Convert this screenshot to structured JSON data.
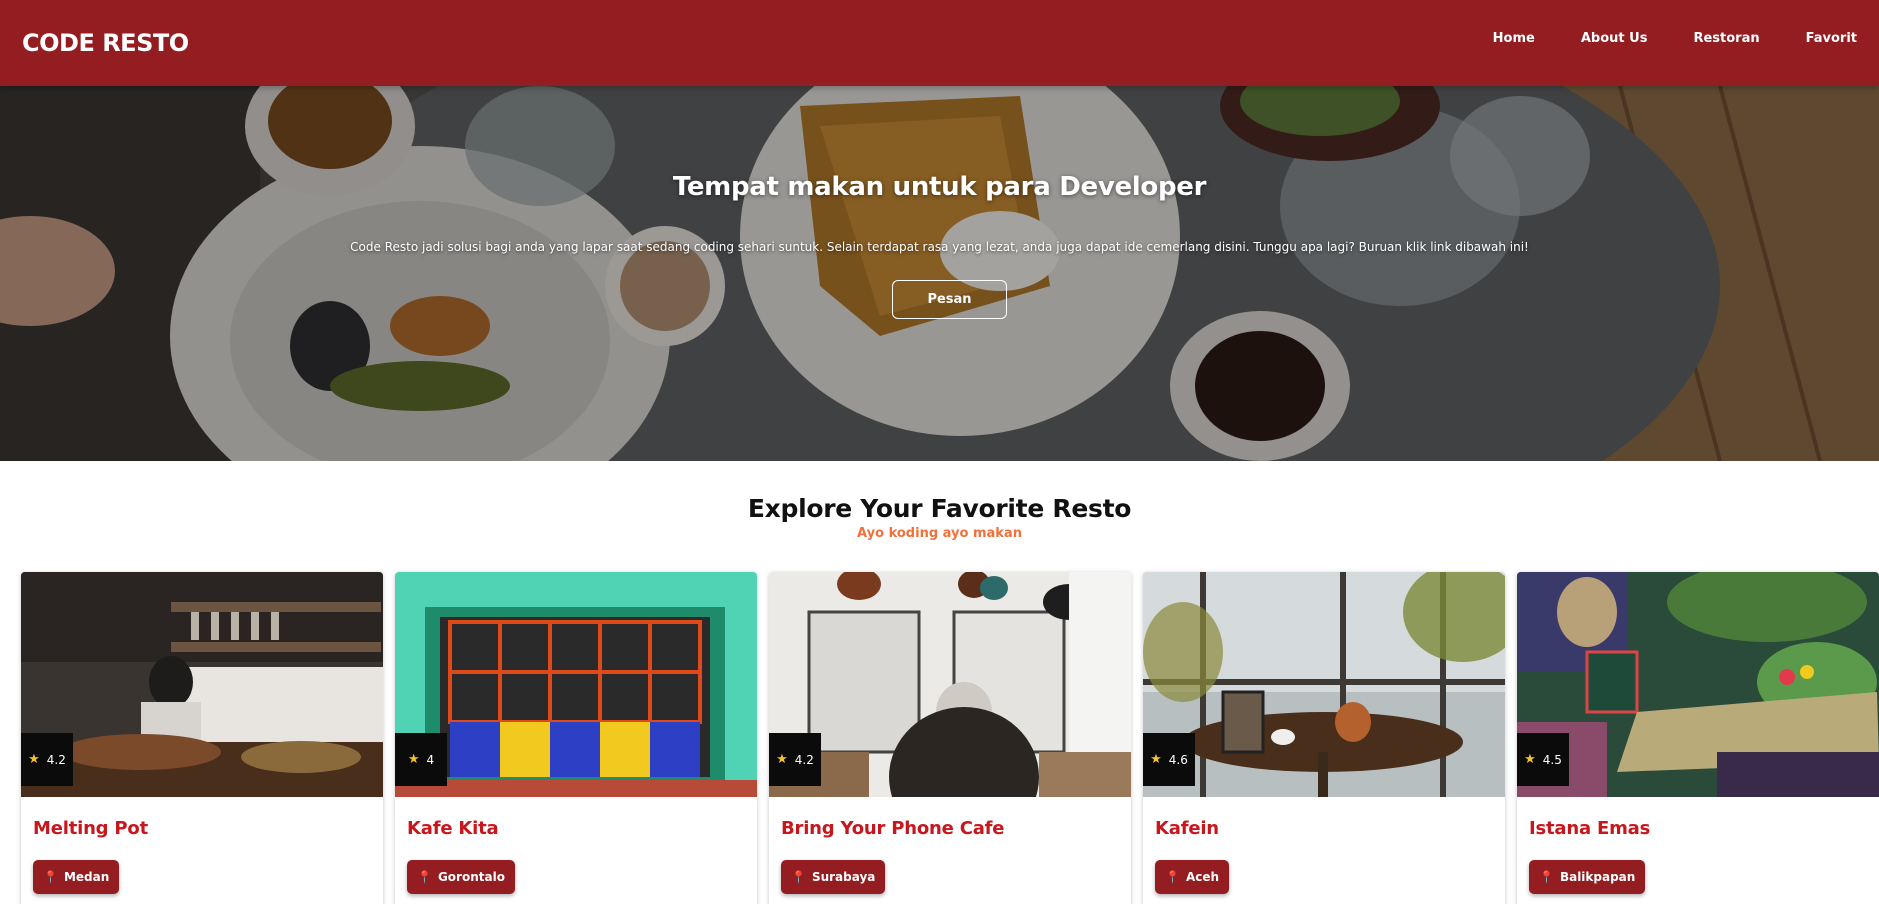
{
  "header": {
    "brand": "CODE RESTO",
    "nav": [
      "Home",
      "About Us",
      "Restoran",
      "Favorit"
    ]
  },
  "hero": {
    "title": "Tempat makan untuk para Developer",
    "description": "Code Resto jadi solusi bagi anda yang lapar saat sedang coding sehari suntuk. Selain terdapat rasa yang lezat, anda juga dapat ide cemerlang disini. Tunggu apa lagi? Buruan klik link dibawah ini!",
    "button_label": "Pesan"
  },
  "explore": {
    "title": "Explore Your Favorite Resto",
    "subtitle": "Ayo koding ayo makan"
  },
  "restaurants": [
    {
      "name": "Melting Pot",
      "city": "Medan",
      "rating": "4.2"
    },
    {
      "name": "Kafe Kita",
      "city": "Gorontalo",
      "rating": "4"
    },
    {
      "name": "Bring Your Phone Cafe",
      "city": "Surabaya",
      "rating": "4.2"
    },
    {
      "name": "Kafein",
      "city": "Aceh",
      "rating": "4.6"
    },
    {
      "name": "Istana Emas",
      "city": "Balikpapan",
      "rating": "4.5"
    }
  ],
  "colors": {
    "header_bg": "#931d20",
    "accent_orange": "#f2703a",
    "name_red": "#c8161d",
    "star_yellow": "#f6c32d"
  },
  "icons": [
    "star-icon",
    "map-pin-icon"
  ]
}
